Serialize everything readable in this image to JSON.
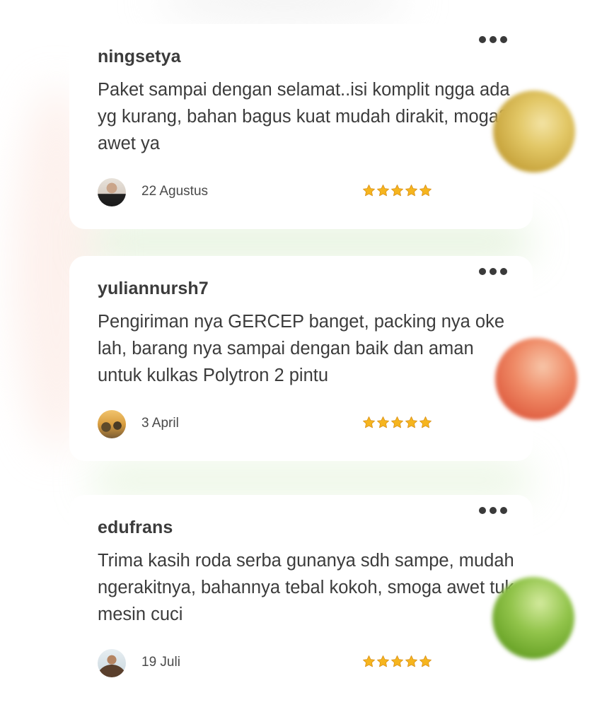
{
  "reviews": [
    {
      "username": "ningsetya",
      "text": "Paket sampai dengan selamat..isi komplit ngga ada yg kurang, bahan bagus kuat mudah dirakit, moga2 awet ya",
      "date": "22 Agustus",
      "rating": 5
    },
    {
      "username": "yuliannursh7",
      "text": "Pengiriman nya GERCEP banget, packing nya oke lah, barang nya sampai dengan baik dan aman untuk kulkas Polytron 2 pintu",
      "date": "3 April",
      "rating": 5
    },
    {
      "username": "edufrans",
      "text": "Trima kasih roda serba gunanya sdh sampe, mudah ngerakitnya, bahannya tebal kokoh, smoga awet tuk mesin cuci",
      "date": "19 Juli",
      "rating": 5
    }
  ],
  "icons": {
    "more": "more-options-icon",
    "star": "star-icon"
  },
  "colors": {
    "star": "#f6b51e",
    "text": "#3c3c3c"
  }
}
